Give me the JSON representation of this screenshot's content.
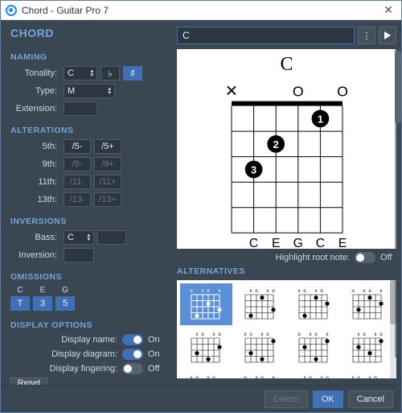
{
  "window": {
    "title": "Chord - Guitar Pro 7"
  },
  "header": {
    "title": "CHORD"
  },
  "search": {
    "value": "C"
  },
  "naming": {
    "title": "NAMING",
    "tonality_label": "Tonality:",
    "tonality_value": "C",
    "flat_label": "♭",
    "sharp_label": "♯",
    "sharp_active": true,
    "type_label": "Type:",
    "type_value": "M",
    "extension_label": "Extension:",
    "extension_value": ""
  },
  "alterations": {
    "title": "ALTERATIONS",
    "rows": [
      {
        "label": "5th:",
        "minus": "/5-",
        "plus": "/5+",
        "enabled": true
      },
      {
        "label": "9th:",
        "minus": "/9-",
        "plus": "/9+",
        "enabled": false
      },
      {
        "label": "11th:",
        "minus": "/11-",
        "plus": "/11+",
        "enabled": false
      },
      {
        "label": "13th:",
        "minus": "/13-",
        "plus": "/13+",
        "enabled": false
      }
    ]
  },
  "inversions": {
    "title": "INVERSIONS",
    "bass_label": "Bass:",
    "bass_value": "C",
    "inversion_label": "Inversion:",
    "inversion_value": ""
  },
  "omissions": {
    "title": "OMISSIONS",
    "cols": [
      {
        "note": "C",
        "interval": "T",
        "on": true
      },
      {
        "note": "E",
        "interval": "3",
        "on": true
      },
      {
        "note": "G",
        "interval": "5",
        "on": true
      }
    ]
  },
  "display": {
    "title": "DISPLAY OPTIONS",
    "items": [
      {
        "label": "Display name:",
        "on": true
      },
      {
        "label": "Display diagram:",
        "on": true
      },
      {
        "label": "Display fingering:",
        "on": false
      }
    ],
    "on_text": "On",
    "off_text": "Off"
  },
  "diagram": {
    "name": "C",
    "strings_top": [
      "x",
      "",
      "",
      "o",
      "",
      "o"
    ],
    "fingers": [
      {
        "string": 4,
        "fret": 0,
        "num": "1"
      },
      {
        "string": 2,
        "fret": 1,
        "num": "2"
      },
      {
        "string": 1,
        "fret": 2,
        "num": "3"
      }
    ],
    "bottom_notes": [
      "C",
      "E",
      "G",
      "C",
      "E"
    ]
  },
  "highlight": {
    "label": "Highlight root note:",
    "on": false
  },
  "alternatives": {
    "title": "ALTERNATIVES",
    "count": 12,
    "selected_index": 0
  },
  "buttons": {
    "reset": "Reset",
    "delete": "Delete",
    "ok": "OK",
    "cancel": "Cancel"
  }
}
